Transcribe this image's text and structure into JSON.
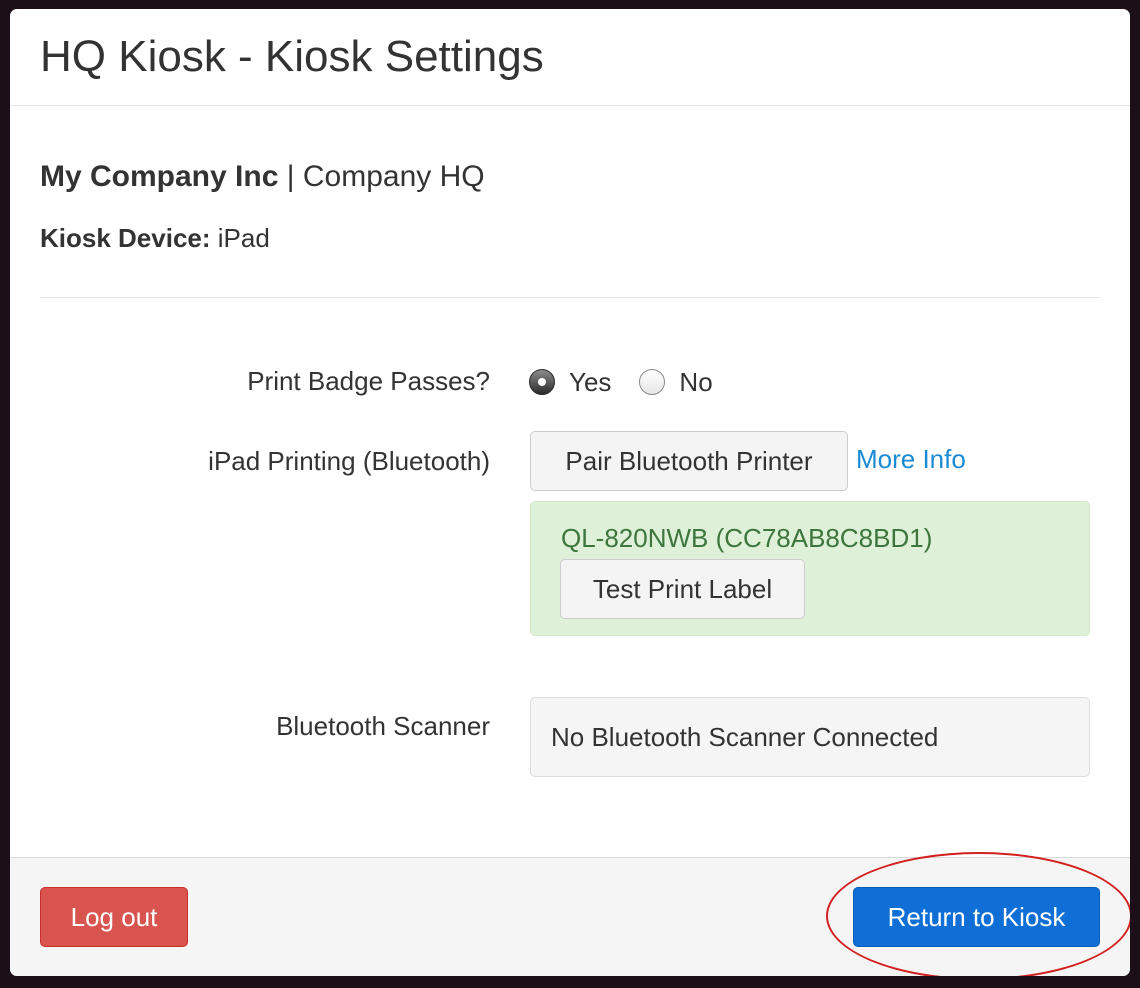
{
  "modal": {
    "title": "HQ Kiosk - Kiosk Settings"
  },
  "info": {
    "company_name": "My Company Inc",
    "separator": "|",
    "location": "Company HQ",
    "device_label": "Kiosk Device:",
    "device_value": "iPad"
  },
  "settings": {
    "print_badge": {
      "label": "Print Badge Passes?",
      "options": [
        {
          "label": "Yes",
          "checked": true
        },
        {
          "label": "No",
          "checked": false
        }
      ]
    },
    "ipad_printing": {
      "label": "iPad Printing (Bluetooth)",
      "pair_button": "Pair Bluetooth Printer",
      "more_info_link": "More Info",
      "connected_printer": "QL-820NWB (CC78AB8C8BD1)",
      "test_print_button": "Test Print Label"
    },
    "bluetooth_scanner": {
      "label": "Bluetooth Scanner",
      "status": "No Bluetooth Scanner Connected"
    }
  },
  "footer": {
    "logout_button": "Log out",
    "return_button": "Return to Kiosk"
  },
  "colors": {
    "primary": "#0f6fd6",
    "danger": "#d9534f",
    "success_bg": "#dff0d8",
    "success_text": "#3c763d",
    "link": "#1a8bd4",
    "annotation": "#d21f1f"
  }
}
